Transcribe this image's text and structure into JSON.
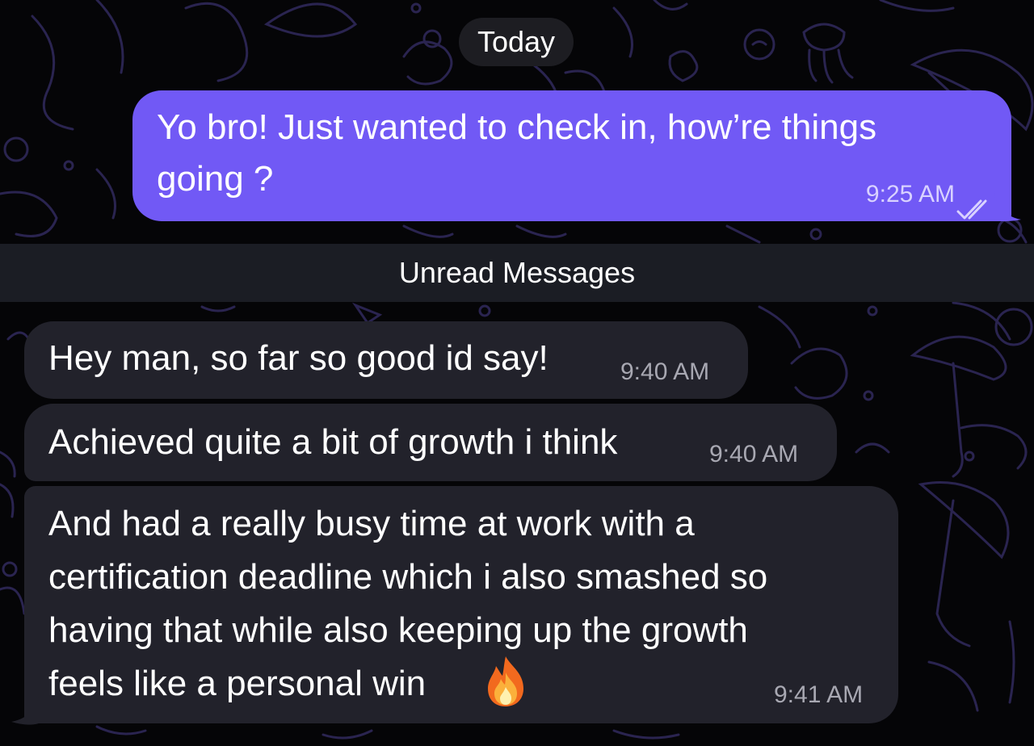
{
  "chat": {
    "date_label": "Today",
    "unread_label": "Unread Messages",
    "outgoing": [
      {
        "text_lines": [
          "Yo bro! Just wanted to check in, how’re things",
          "going ?"
        ],
        "time": "9:25 AM",
        "status_icon": "double-check-icon"
      }
    ],
    "incoming": [
      {
        "text": "Hey man, so far so good id say!",
        "time": "9:40 AM"
      },
      {
        "text": "Achieved quite a bit of growth i think",
        "time": "9:40 AM"
      },
      {
        "text_lines": [
          "And had a really busy time at work with a",
          "certification deadline which i also smashed so",
          "having that while also keeping up the growth",
          "feels like a personal win"
        ],
        "emoji": "fire-emoji",
        "time": "9:41 AM"
      }
    ]
  },
  "colors": {
    "background": "#050507",
    "outgoing_bubble": "#7159f5",
    "incoming_bubble": "#22222b",
    "unread_bar": "#1b1d24",
    "date_chip": "#1d1d22",
    "wallpaper_lines": "#2a2450"
  }
}
